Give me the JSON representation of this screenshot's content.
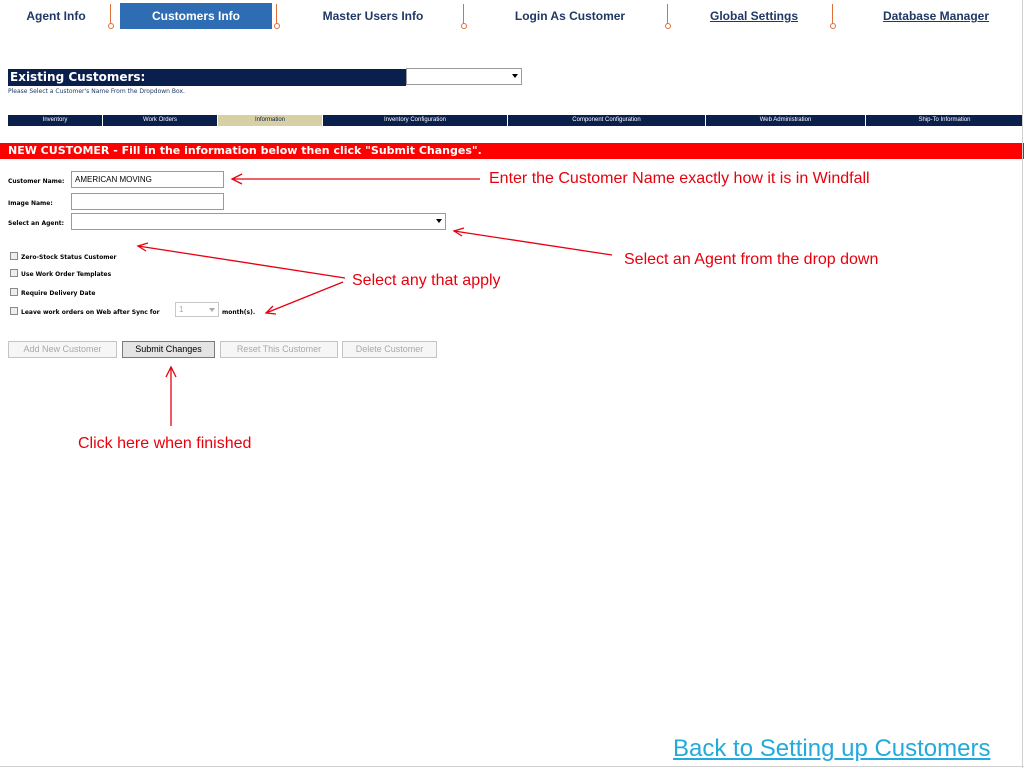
{
  "nav": {
    "items": [
      {
        "label": "Agent Info"
      },
      {
        "label": "Customers Info"
      },
      {
        "label": "Master Users Info"
      },
      {
        "label": "Login As Customer"
      },
      {
        "label": "Global Settings"
      },
      {
        "label": "Database Manager"
      }
    ]
  },
  "existing": {
    "title": "Existing Customers:",
    "hint": "Please Select a Customer's Name From the Dropdown Box.",
    "selected": ""
  },
  "subtabs": [
    {
      "label": "Inventory"
    },
    {
      "label": "Work Orders"
    },
    {
      "label": "Information"
    },
    {
      "label": "Inventory Configuration"
    },
    {
      "label": "Component Configuration"
    },
    {
      "label": "Web Administration"
    },
    {
      "label": "Ship-To Information"
    }
  ],
  "banner": "NEW CUSTOMER - Fill in the information below then click \"Submit Changes\".",
  "form": {
    "customer_name_label": "Customer Name:",
    "customer_name_value": "AMERICAN MOVING",
    "image_name_label": "Image Name:",
    "image_name_value": "",
    "agent_label": "Select an Agent:",
    "agent_value": "",
    "checkboxes": [
      {
        "label": "Zero-Stock Status Customer",
        "checked": false
      },
      {
        "label": "Use Work Order Templates",
        "checked": false
      },
      {
        "label": "Require Delivery Date",
        "checked": false
      },
      {
        "label": "Leave work orders on Web after Sync for",
        "checked": false
      }
    ],
    "months_value": "1",
    "months_suffix": "month(s)."
  },
  "buttons": {
    "add": "Add New Customer",
    "submit": "Submit Changes",
    "reset": "Reset This Customer",
    "delete": "Delete Customer"
  },
  "annotations": {
    "customer_name": "Enter the Customer Name exactly how it is in Windfall",
    "agent": "Select an Agent from the drop down",
    "checkboxes": "Select any that apply",
    "submit": "Click here when finished"
  },
  "back_link": "Back to Setting up Customers",
  "colors": {
    "nav_text": "#1f3864",
    "nav_active": "#2e6db4",
    "dark_blue": "#0b1f4d",
    "banner": "#ff0000",
    "annotation": "#e8000d",
    "link": "#22aadd"
  }
}
